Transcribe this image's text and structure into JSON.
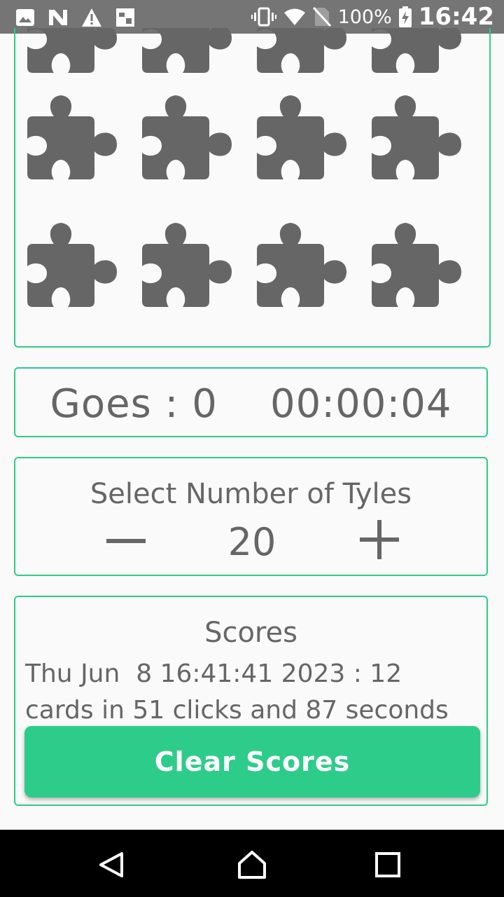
{
  "status_bar": {
    "icons_left": [
      "image-icon",
      "n-icon",
      "warning-icon",
      "gallery-icon"
    ],
    "icons_right": [
      "vibrate-icon",
      "wifi-icon",
      "no-sim-icon",
      "battery-charging-icon"
    ],
    "battery": "100%",
    "time": "16:42"
  },
  "board": {
    "tile_icon": "puzzle-piece-icon",
    "tile_color": "#666666",
    "visible_rows": 3,
    "columns": 4
  },
  "game": {
    "goes_text": "Goes : 0    00:00:04"
  },
  "tyles": {
    "title": "Select Number of Tyles",
    "value": "20",
    "decrease_icon": "minus-icon",
    "increase_icon": "plus-icon"
  },
  "scores": {
    "title": "Scores",
    "entry": "Thu Jun  8 16:41:41 2023 : 12 cards in 51 clicks and 87 seconds",
    "clear_label": "Clear Scores"
  },
  "nav": {
    "icons": [
      "back-icon",
      "home-icon",
      "recents-icon"
    ]
  },
  "colors": {
    "accent": "#2ecc8a",
    "text": "#666666",
    "status_bar": "#757575"
  }
}
